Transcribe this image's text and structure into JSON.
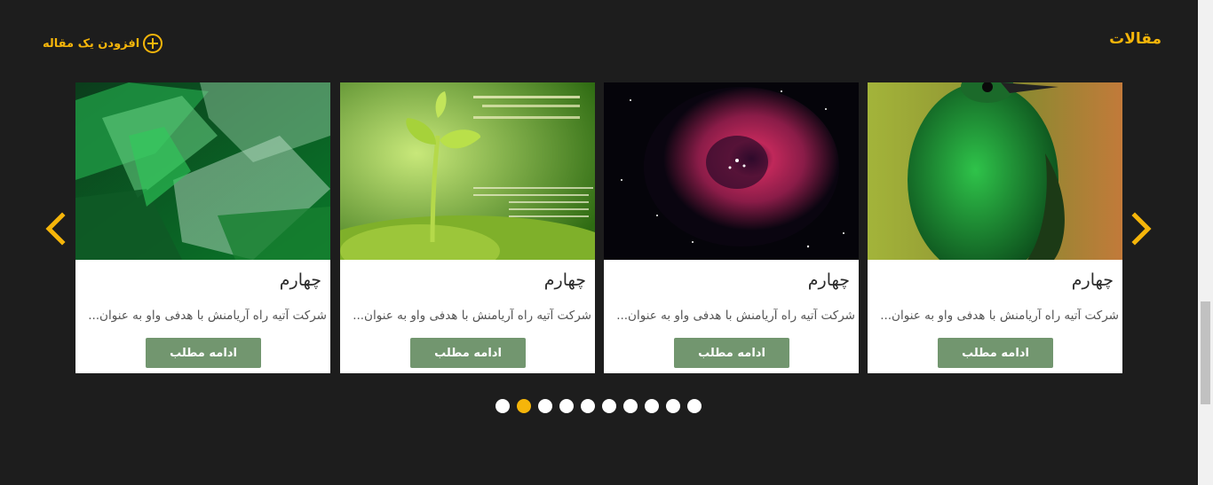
{
  "header": {
    "section_title": "مقالات",
    "add_article_label": "افزودن یک مقاله"
  },
  "carousel": {
    "cards": [
      {
        "title": "چهارم",
        "excerpt": "شرکت آتیه راه آریامنش با هدفی واو به عنوان...",
        "button_label": "ادامه مطلب",
        "image": "emerald-crystals"
      },
      {
        "title": "چهارم",
        "excerpt": "شرکت آتیه راه آریامنش با هدفی واو به عنوان...",
        "button_label": "ادامه مطلب",
        "image": "green-sprout"
      },
      {
        "title": "چهارم",
        "excerpt": "شرکت آتیه راه آریامنش با هدفی واو به عنوان...",
        "button_label": "ادامه مطلب",
        "image": "rosette-nebula"
      },
      {
        "title": "چهارم",
        "excerpt": "شرکت آتیه راه آریامنش با هدفی واو به عنوان...",
        "button_label": "ادامه مطلب",
        "image": "green-hummingbird"
      }
    ],
    "pagination": {
      "total": 10,
      "active_index": 1
    },
    "arrows": {
      "prev_icon": "chevron-left-icon",
      "next_icon": "chevron-right-icon"
    }
  },
  "colors": {
    "background": "#1d1d1d",
    "accent": "#f5b50a",
    "button": "#72966f"
  }
}
